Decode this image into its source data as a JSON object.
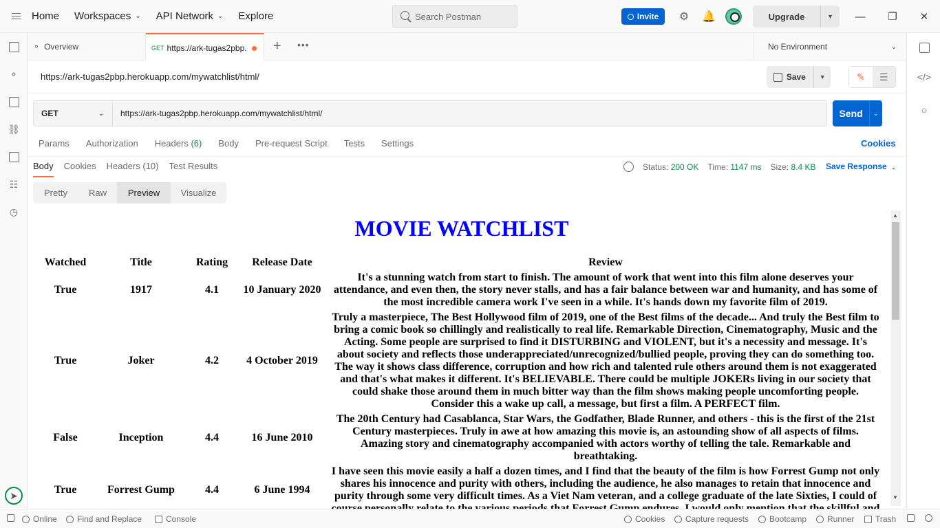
{
  "topbar": {
    "nav": [
      {
        "label": "Home",
        "dropdown": false
      },
      {
        "label": "Workspaces",
        "dropdown": true
      },
      {
        "label": "API Network",
        "dropdown": true
      },
      {
        "label": "Explore",
        "dropdown": false
      }
    ],
    "search_placeholder": "Search Postman",
    "invite_label": "Invite",
    "upgrade_label": "Upgrade"
  },
  "tabs": {
    "overview_label": "Overview",
    "active_method": "GET",
    "active_label": "https://ark-tugas2pbp.",
    "environment": "No Environment"
  },
  "request": {
    "title_url": "https://ark-tugas2pbp.herokuapp.com/mywatchlist/html/",
    "save_label": "Save",
    "method": "GET",
    "url": "https://ark-tugas2pbp.herokuapp.com/mywatchlist/html/",
    "send_label": "Send",
    "tabs": [
      {
        "label": "Params",
        "count": ""
      },
      {
        "label": "Authorization",
        "count": ""
      },
      {
        "label": "Headers",
        "count": "(6)"
      },
      {
        "label": "Body",
        "count": ""
      },
      {
        "label": "Pre-request Script",
        "count": ""
      },
      {
        "label": "Tests",
        "count": ""
      },
      {
        "label": "Settings",
        "count": ""
      }
    ],
    "cookies_label": "Cookies"
  },
  "response": {
    "tabs": [
      "Body",
      "Cookies",
      "Headers (10)",
      "Test Results"
    ],
    "status_label": "Status:",
    "status_value": "200 OK",
    "time_label": "Time:",
    "time_value": "1147 ms",
    "size_label": "Size:",
    "size_value": "8.4 KB",
    "save_response_label": "Save Response",
    "view_modes": [
      "Pretty",
      "Raw",
      "Preview",
      "Visualize"
    ],
    "active_view": "Preview"
  },
  "preview": {
    "heading": "MOVIE WATCHLIST",
    "columns": [
      "Watched",
      "Title",
      "Rating",
      "Release Date",
      "Review"
    ],
    "rows": [
      {
        "watched": "True",
        "title": "1917",
        "rating": "4.1",
        "release_date": "10 January 2020",
        "review": "It's a stunning watch from start to finish. The amount of work that went into this film alone deserves your attendance, and even then, the story never stalls, and has a fair balance between war and humanity, and has some of the most incredible camera work I've seen in a while. It's hands down my favorite film of 2019."
      },
      {
        "watched": "True",
        "title": "Joker",
        "rating": "4.2",
        "release_date": "4 October 2019",
        "review": "Truly a masterpiece, The Best Hollywood film of 2019, one of the Best films of the decade... And truly the Best film to bring a comic book so chillingly and realistically to real life. Remarkable Direction, Cinematography, Music and the Acting. Some people are surprised to find it DISTURBING and VIOLENT, but it's a necessity and message. It's about society and reflects those underappreciated/unrecognized/bullied people, proving they can do something too. The way it shows class difference, corruption and how rich and talented rule others around them is not exaggerated and that's what makes it different. It's BELIEVABLE. There could be multiple JOKERs living in our society that could shake those around them in much bitter way than the film shows making people uncomforting people. Consider this a wake up call, a message, but first a film. A PERFECT film."
      },
      {
        "watched": "False",
        "title": "Inception",
        "rating": "4.4",
        "release_date": "16 June 2010",
        "review": "The 20th Century had Casablanca, Star Wars, the Godfather, Blade Runner, and others - this is the first of the 21st Century masterpieces. Truly in awe at how amazing this movie is, an astounding show of all aspects of films. Amazing story and cinematography accompanied with actors worthy of telling the tale. Remarkable and breathtaking."
      },
      {
        "watched": "True",
        "title": "Forrest Gump",
        "rating": "4.4",
        "release_date": "6 June 1994",
        "review": "I have seen this movie easily a half a dozen times, and I find that the beauty of the film is how Forrest Gump not only shares his innocence and purity with others, including the audience, he also manages to retain that innocence and purity through some very difficult times. As a Viet Nam veteran, and a college graduate of the late Sixties, I could of course personally relate to the various periods that Forrest Gump endures. I would only mention that the skillful and"
      }
    ]
  },
  "statusbar": {
    "online_label": "Online",
    "find_replace_label": "Find and Replace",
    "console_label": "Console",
    "cookies_label": "Cookies",
    "capture_label": "Capture requests",
    "bootcamp_label": "Bootcamp",
    "runner_label": "Runner",
    "trash_label": "Trash"
  },
  "colors": {
    "accent_orange": "#ff6c37",
    "primary_blue": "#0265d2",
    "status_green": "#0f8a4b",
    "heading_blue": "#0000ff"
  },
  "icons": [
    "menu-icon",
    "search-icon",
    "settings-icon",
    "bell-icon",
    "avatar",
    "minimize-icon",
    "maximize-icon",
    "close-icon",
    "save-icon",
    "edit-icon",
    "comment-icon",
    "globe-icon",
    "code-icon",
    "bulb-icon"
  ]
}
